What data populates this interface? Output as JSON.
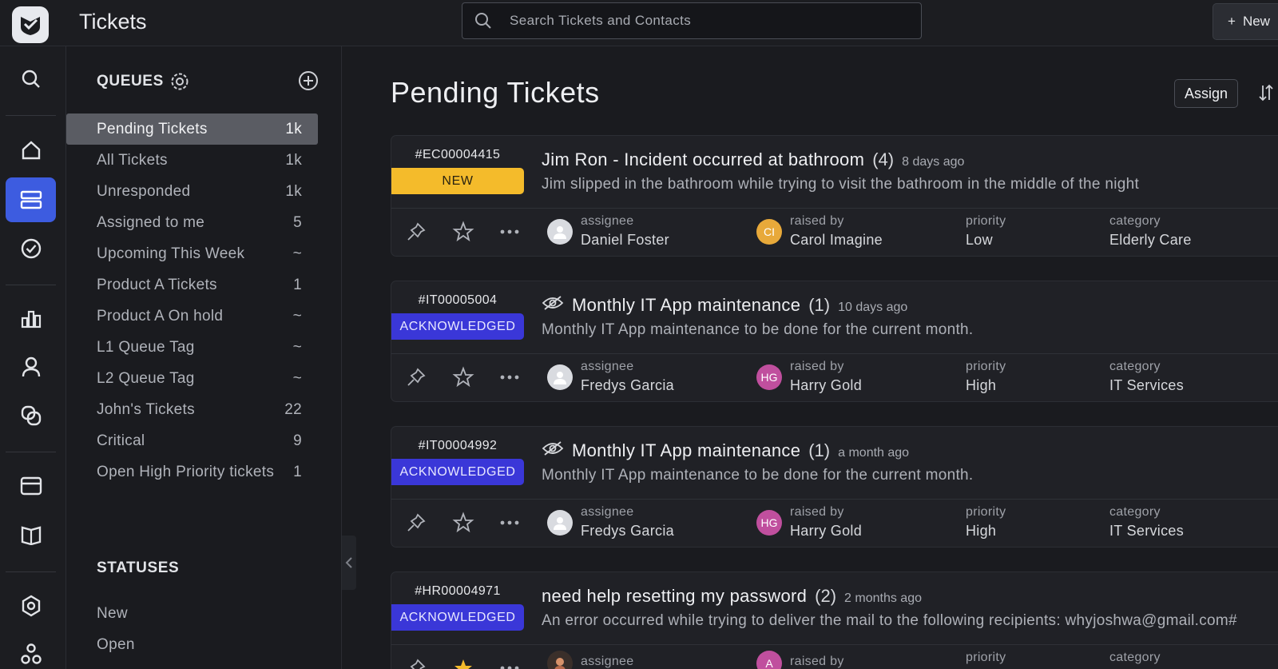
{
  "app": {
    "title": "Tickets",
    "search_placeholder": "Search Tickets and Contacts",
    "new_label": "New"
  },
  "queues": {
    "heading": "QUEUES",
    "items": [
      {
        "label": "Pending Tickets",
        "count": "1k"
      },
      {
        "label": "All Tickets",
        "count": "1k"
      },
      {
        "label": "Unresponded",
        "count": "1k"
      },
      {
        "label": "Assigned to me",
        "count": "5"
      },
      {
        "label": "Upcoming This Week",
        "count": "~"
      },
      {
        "label": "Product A Tickets",
        "count": "1"
      },
      {
        "label": "Product A On hold",
        "count": "~"
      },
      {
        "label": "L1 Queue Tag",
        "count": "~"
      },
      {
        "label": "L2 Queue Tag",
        "count": "~"
      },
      {
        "label": "John's Tickets",
        "count": "22"
      },
      {
        "label": "Critical",
        "count": "9"
      },
      {
        "label": "Open High Priority tickets",
        "count": "1"
      }
    ]
  },
  "statuses": {
    "heading": "STATUSES",
    "items": [
      {
        "label": "New"
      },
      {
        "label": "Open"
      }
    ]
  },
  "main": {
    "title": "Pending Tickets",
    "assign_label": "Assign"
  },
  "labels": {
    "assignee": "assignee",
    "raised_by": "raised by",
    "priority": "priority",
    "category": "category"
  },
  "tickets": [
    {
      "id": "#EC00004415",
      "status": "NEW",
      "title": "Jim Ron - Incident occurred at bathroom",
      "count": "(4)",
      "age": "8 days ago",
      "desc": "Jim slipped in the bathroom while trying to visit the bathroom in the middle of the night",
      "assignee": "Daniel Foster",
      "raiser_initials": "CI",
      "raised_by": "Carol Imagine",
      "priority": "Low",
      "category": "Elderly Care"
    },
    {
      "id": "#IT00005004",
      "status": "ACKNOWLEDGED",
      "title": "Monthly IT App maintenance",
      "count": "(1)",
      "age": "10 days ago",
      "desc": "Monthly IT App maintenance to be done for the current month.",
      "assignee": "Fredys Garcia",
      "raiser_initials": "HG",
      "raised_by": "Harry Gold",
      "priority": "High",
      "category": "IT Services"
    },
    {
      "id": "#IT00004992",
      "status": "ACKNOWLEDGED",
      "title": "Monthly IT App maintenance",
      "count": "(1)",
      "age": "a month ago",
      "desc": "Monthly IT App maintenance to be done for the current month.",
      "assignee": "Fredys Garcia",
      "raiser_initials": "HG",
      "raised_by": "Harry Gold",
      "priority": "High",
      "category": "IT Services"
    },
    {
      "id": "#HR00004971",
      "status": "ACKNOWLEDGED",
      "title": "need help resetting my password",
      "count": "(2)",
      "age": "2 months ago",
      "desc": "An error occurred while trying to deliver the mail to the following recipients: whyjoshwa@gmail.com#",
      "assignee": "",
      "raiser_initials": "A",
      "raised_by": "",
      "priority": "",
      "category": ""
    }
  ],
  "colors": {
    "accent": "#3d5ce0",
    "badge_new": "#f4bb2b",
    "badge_ack": "#3a37d8",
    "avatar_ci": "#e8a93a",
    "avatar_hg": "#c04f9e"
  }
}
